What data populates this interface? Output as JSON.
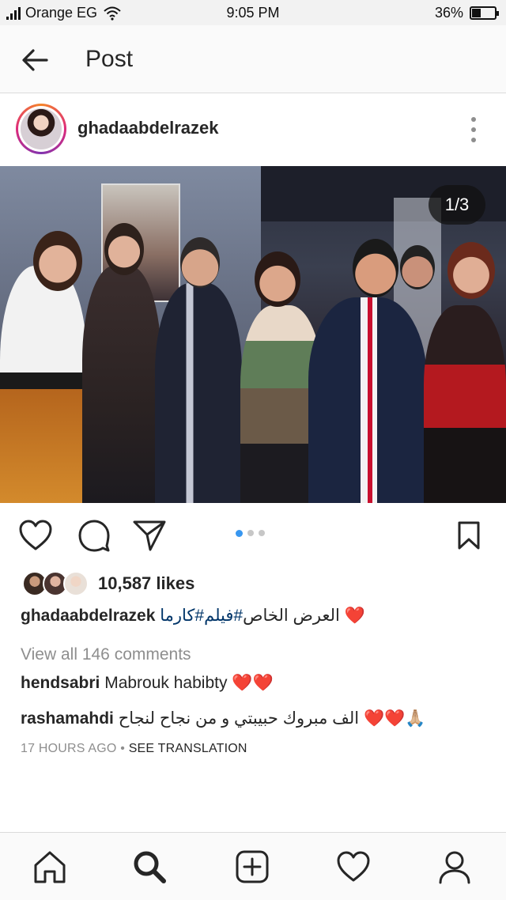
{
  "status_bar": {
    "carrier": "Orange EG",
    "time": "9:05 PM",
    "battery": "36%",
    "battery_level": 0.36
  },
  "header": {
    "title": "Post",
    "back_icon": "back-arrow-icon"
  },
  "post": {
    "username": "ghadaabdelrazek",
    "image_counter": "1/3",
    "carousel_pages": 3,
    "carousel_active": 1,
    "likes": "10,587 likes",
    "caption": {
      "username": "ghadaabdelrazek",
      "text": "العرض الخاص",
      "hashtags": "#فيلم#كارما",
      "emoji": "❤️"
    },
    "view_all_comments": "View all 146 comments",
    "comments": [
      {
        "username": "hendsabri",
        "text": "Mabrouk habibty",
        "emoji": "❤️❤️"
      },
      {
        "username": "rashamahdi",
        "text": "الف مبروك حبيبتي و من نجاح لنجاح",
        "emoji": "❤️❤️🙏🏼"
      }
    ],
    "timestamp": "17 HOURS AGO",
    "separator": "•",
    "see_translation": "SEE TRANSLATION"
  },
  "colors": {
    "accent_blue": "#3897f0",
    "heart_red": "#ed1b24",
    "text": "#262626",
    "muted": "#8e8e8e",
    "hashtag": "#003569"
  },
  "bottom_nav": [
    "home-icon",
    "search-icon",
    "add-post-icon",
    "activity-heart-icon",
    "profile-icon"
  ]
}
